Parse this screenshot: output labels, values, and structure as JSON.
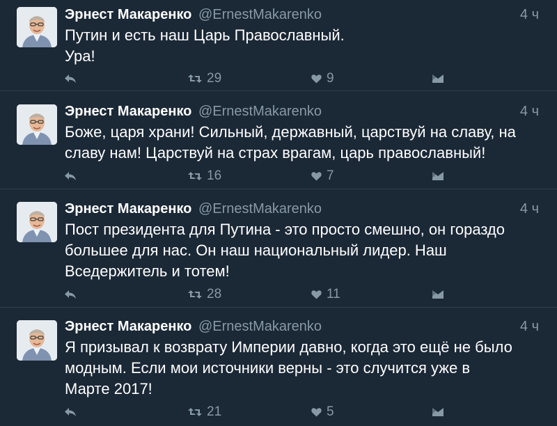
{
  "tweets": [
    {
      "name": "Эрнест Макаренко",
      "handle": "@ErnestMakarenko",
      "time": "4 ч",
      "text": "Путин и есть наш Царь Православный.\nУра!",
      "retweets": "29",
      "likes": "9"
    },
    {
      "name": "Эрнест Макаренко",
      "handle": "@ErnestMakarenko",
      "time": "4 ч",
      "text": "Боже, царя храни! Сильный, державный, царствуй на славу, на\nславу нам! Царствуй на страх врагам, царь православный!",
      "retweets": "16",
      "likes": "7"
    },
    {
      "name": "Эрнест Макаренко",
      "handle": "@ErnestMakarenko",
      "time": "4 ч",
      "text": "Пост президента для Путина - это просто смешно, он гораздо\nбольшее для нас. Он наш национальный лидер. Наш\nВседержитель и тотем!",
      "retweets": "28",
      "likes": "11"
    },
    {
      "name": "Эрнест Макаренко",
      "handle": "@ErnestMakarenko",
      "time": "4 ч",
      "text": "Я призывал к возврату Империи давно, когда это ещё не было\nмодным. Если мои источники верны - это случится уже в\nМарте 2017!",
      "retweets": "21",
      "likes": "5"
    }
  ],
  "icons": {
    "reply": "reply-icon",
    "retweet": "retweet-icon",
    "like": "heart-icon",
    "message": "direct-message-icon"
  },
  "colors": {
    "background": "#1b2836",
    "divider": "#2f3e4d",
    "text": "#ffffff",
    "muted": "#8899a6"
  }
}
